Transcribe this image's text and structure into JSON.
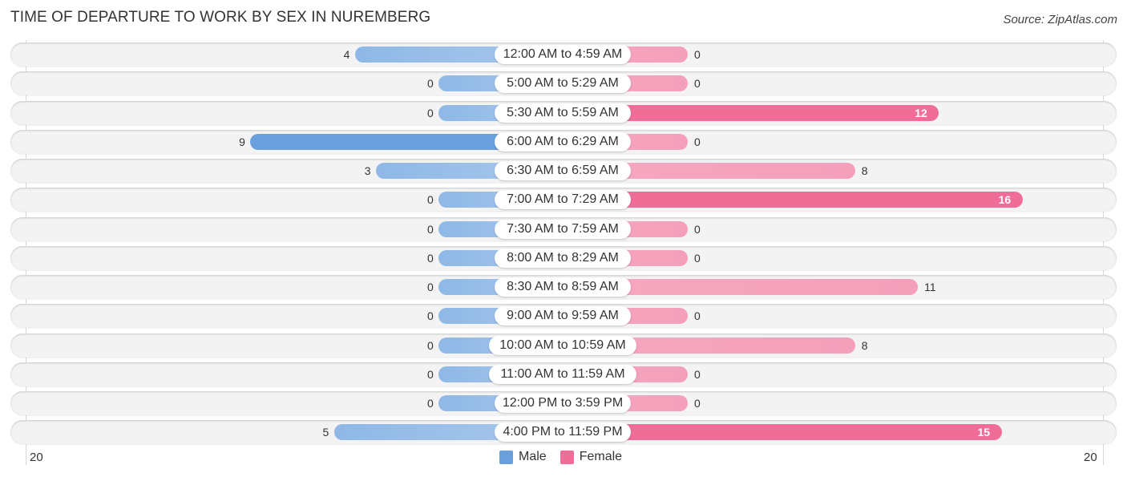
{
  "title": "TIME OF DEPARTURE TO WORK BY SEX IN NUREMBERG",
  "source": "Source: ZipAtlas.com",
  "colors": {
    "male": "#6a9fdc",
    "female": "#f06d97"
  },
  "chart_data": {
    "type": "bar",
    "orientation": "horizontal-diverging",
    "title": "TIME OF DEPARTURE TO WORK BY SEX IN NUREMBERG",
    "categories": [
      "12:00 AM to 4:59 AM",
      "5:00 AM to 5:29 AM",
      "5:30 AM to 5:59 AM",
      "6:00 AM to 6:29 AM",
      "6:30 AM to 6:59 AM",
      "7:00 AM to 7:29 AM",
      "7:30 AM to 7:59 AM",
      "8:00 AM to 8:29 AM",
      "8:30 AM to 8:59 AM",
      "9:00 AM to 9:59 AM",
      "10:00 AM to 10:59 AM",
      "11:00 AM to 11:59 AM",
      "12:00 PM to 3:59 PM",
      "4:00 PM to 11:59 PM"
    ],
    "series": [
      {
        "name": "Male",
        "values": [
          4,
          0,
          0,
          9,
          3,
          0,
          0,
          0,
          0,
          0,
          0,
          0,
          0,
          5
        ]
      },
      {
        "name": "Female",
        "values": [
          0,
          0,
          12,
          0,
          8,
          16,
          0,
          0,
          11,
          0,
          8,
          0,
          0,
          15
        ]
      }
    ],
    "axis": {
      "left_tick": "20",
      "right_tick": "20",
      "range": [
        0,
        20
      ]
    },
    "legend": {
      "position": "bottom-center",
      "entries": [
        "Male",
        "Female"
      ]
    }
  }
}
